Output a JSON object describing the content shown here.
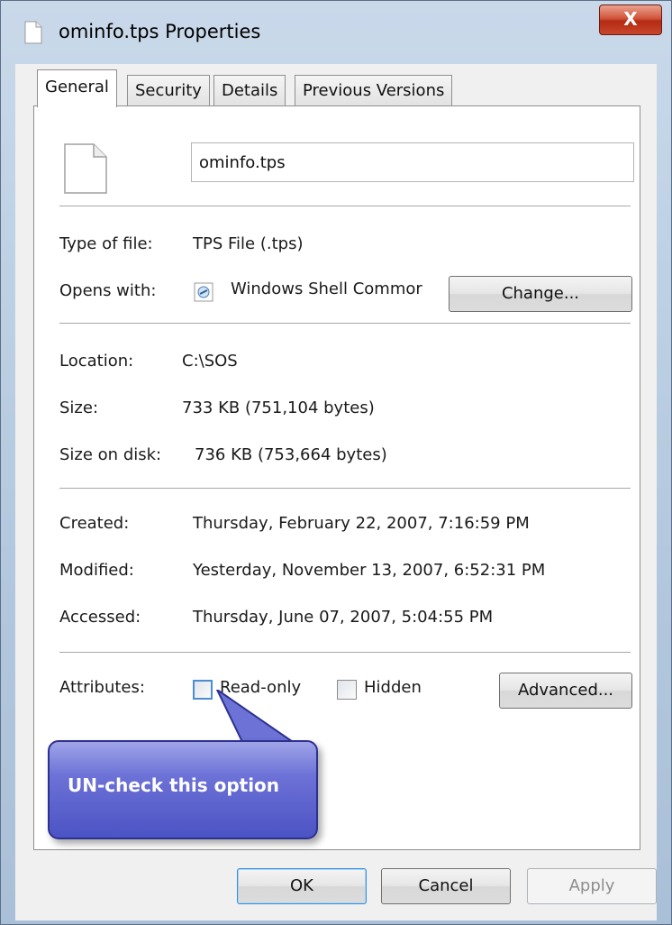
{
  "window": {
    "title": "ominfo.tps Properties",
    "close_label": "X"
  },
  "tabs": [
    {
      "label": "General",
      "active": true
    },
    {
      "label": "Security",
      "active": false
    },
    {
      "label": "Details",
      "active": false
    },
    {
      "label": "Previous Versions",
      "active": false
    }
  ],
  "general": {
    "filename": "ominfo.tps",
    "type_label": "Type of file:",
    "type_value": "TPS File (.tps)",
    "opens_label": "Opens with:",
    "opens_value": "Windows Shell Commor",
    "change_button": "Change...",
    "location_label": "Location:",
    "location_value": "C:\\SOS",
    "size_label": "Size:",
    "size_value": "733 KB (751,104 bytes)",
    "size_disk_label": "Size on disk:",
    "size_disk_value": "736 KB (753,664 bytes)",
    "created_label": "Created:",
    "created_value": "Thursday, February 22, 2007, 7:16:59 PM",
    "modified_label": "Modified:",
    "modified_value": "Yesterday, November 13, 2007, 6:52:31 PM",
    "accessed_label": "Accessed:",
    "accessed_value": "Thursday, June 07, 2007, 5:04:55 PM",
    "attributes_label": "Attributes:",
    "readonly_label": "Read-only",
    "readonly_checked": false,
    "hidden_label": "Hidden",
    "hidden_checked": false,
    "advanced_button": "Advanced..."
  },
  "callout": {
    "text": "UN-check this option",
    "color": "#4c53c4"
  },
  "footer": {
    "ok_label": "OK",
    "cancel_label": "Cancel",
    "apply_label": "Apply"
  },
  "icons": {
    "title": "document-icon",
    "file": "document-icon",
    "opens_with": "shell-app-icon",
    "close": "close-icon"
  }
}
